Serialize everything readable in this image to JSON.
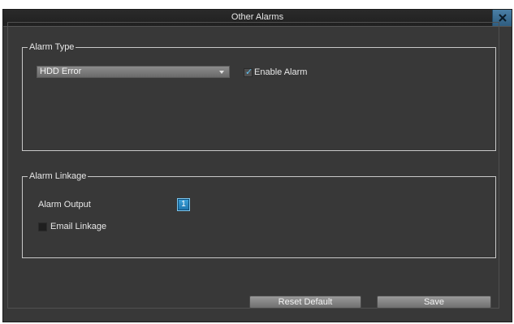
{
  "window": {
    "title": "Other Alarms",
    "close_icon": "close-icon"
  },
  "alarm_type": {
    "legend": "Alarm Type",
    "select_value": "HDD Error",
    "enable_alarm_label": "Enable Alarm",
    "enable_alarm_checked": true
  },
  "alarm_linkage": {
    "legend": "Alarm Linkage",
    "alarm_output_label": "Alarm Output",
    "alarm_output_channel": "1",
    "email_linkage_label": "Email Linkage",
    "email_linkage_checked": false
  },
  "buttons": {
    "reset_default": "Reset Default",
    "save": "Save"
  },
  "colors": {
    "panel_bg": "#383838",
    "accent": "#2f5d80",
    "check": "#5fc0f0"
  }
}
